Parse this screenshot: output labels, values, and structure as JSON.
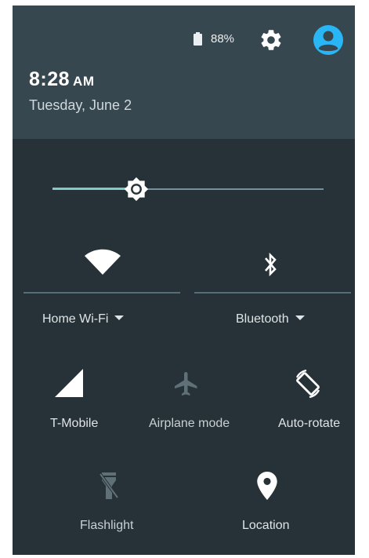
{
  "status": {
    "battery_pct": "88%",
    "time": "8:28",
    "ampm": "AM",
    "date": "Tuesday, June 2"
  },
  "brightness": {
    "level": 0.31
  },
  "tiles": {
    "wifi": {
      "label": "Home Wi-Fi"
    },
    "bluetooth": {
      "label": "Bluetooth"
    },
    "cellular": {
      "label": "T-Mobile"
    },
    "airplane": {
      "label": "Airplane mode"
    },
    "autorotate": {
      "label": "Auto-rotate"
    },
    "flashlight": {
      "label": "Flashlight"
    },
    "location": {
      "label": "Location"
    }
  },
  "colors": {
    "panel_bg": "#263238",
    "header_bg": "#37474f",
    "accent": "#80cbc4",
    "avatar": "#29b6f6"
  }
}
